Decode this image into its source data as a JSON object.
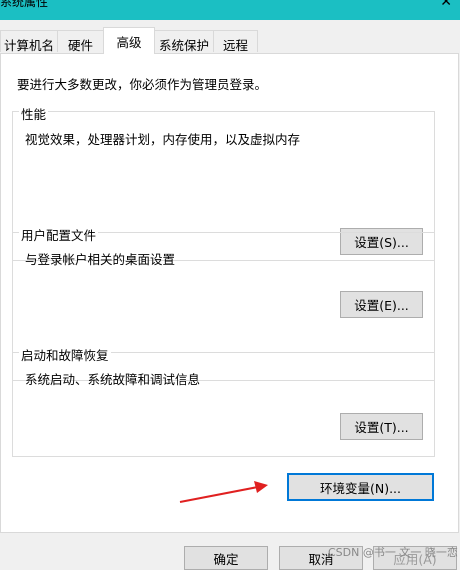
{
  "window": {
    "title": "系统属性",
    "close_glyph": "✕"
  },
  "tabs": [
    {
      "label": "计算机名",
      "active": false
    },
    {
      "label": "硬件",
      "active": false
    },
    {
      "label": "高级",
      "active": true
    },
    {
      "label": "系统保护",
      "active": false
    },
    {
      "label": "远程",
      "active": false
    }
  ],
  "panel": {
    "admin_note": "要进行大多数更改，你必须作为管理员登录。",
    "performance": {
      "title": "性能",
      "description": "视觉效果，处理器计划，内存使用，以及虚拟内存",
      "button": "设置(S)..."
    },
    "user_profiles": {
      "title": "用户配置文件",
      "description": "与登录帐户相关的桌面设置",
      "button": "设置(E)..."
    },
    "startup_recovery": {
      "title": "启动和故障恢复",
      "description": "系统启动、系统故障和调试信息",
      "button": "设置(T)..."
    },
    "env_button": "环境变量(N)..."
  },
  "footer": {
    "ok": "确定",
    "cancel": "取消",
    "apply": "应用(A)"
  },
  "watermark": "CSDN @书一 文一 晓一恋",
  "colors": {
    "titlebar": "#1bbfc3",
    "arrow": "#e02020",
    "focus_border": "#0078d7"
  }
}
